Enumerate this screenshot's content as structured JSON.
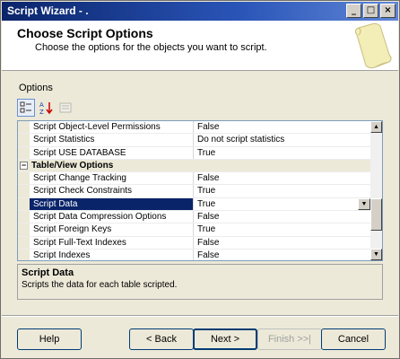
{
  "window": {
    "title": "Script Wizard - .",
    "controls": [
      "_",
      "□",
      "×"
    ]
  },
  "header": {
    "title": "Choose Script Options",
    "subtitle": "Choose the options for the objects you want to script."
  },
  "options_label": "Options",
  "toolbar": {
    "icons": [
      "categorized-icon",
      "alphabetical-icon",
      "property-pages-icon"
    ]
  },
  "grid": {
    "rows": [
      {
        "type": "prop",
        "name": "Script Object-Level Permissions",
        "value": "False"
      },
      {
        "type": "prop",
        "name": "Script Statistics",
        "value": "Do not script statistics"
      },
      {
        "type": "prop",
        "name": "Script USE DATABASE",
        "value": "True"
      },
      {
        "type": "category",
        "name": "Table/View Options",
        "expanded": true
      },
      {
        "type": "prop",
        "name": "Script Change Tracking",
        "value": "False"
      },
      {
        "type": "prop",
        "name": "Script Check Constraints",
        "value": "True"
      },
      {
        "type": "prop",
        "name": "Script Data",
        "value": "True",
        "selected": true
      },
      {
        "type": "prop",
        "name": "Script Data Compression Options",
        "value": "False"
      },
      {
        "type": "prop",
        "name": "Script Foreign Keys",
        "value": "True"
      },
      {
        "type": "prop",
        "name": "Script Full-Text Indexes",
        "value": "False"
      },
      {
        "type": "prop",
        "name": "Script Indexes",
        "value": "False"
      }
    ]
  },
  "description": {
    "title": "Script Data",
    "text": "Scripts the data for each table scripted."
  },
  "buttons": {
    "help": "Help",
    "back": "< Back",
    "next": "Next >",
    "finish": "Finish >>|",
    "cancel": "Cancel"
  },
  "colors": {
    "selection": "#0a246a",
    "title_bar": "#0a246a",
    "dialog_bg": "#ece9d8"
  }
}
